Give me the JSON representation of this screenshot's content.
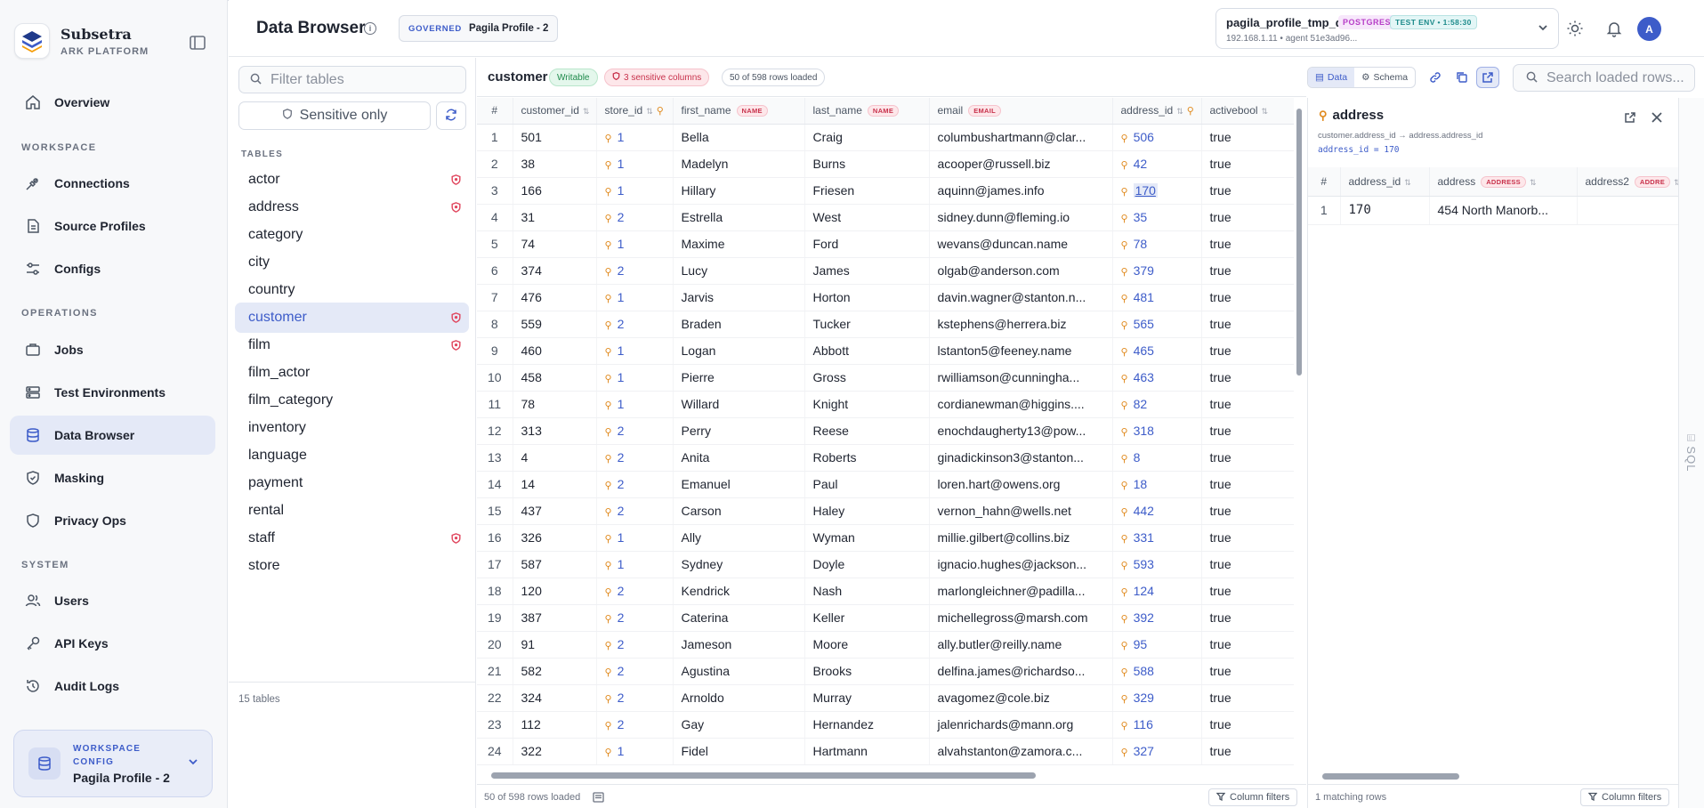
{
  "app": {
    "name": "Subsetra",
    "subtitle": "ARK PLATFORM"
  },
  "nav": {
    "overview": "Overview",
    "workspace_section": "WORKSPACE",
    "connections": "Connections",
    "source_profiles": "Source Profiles",
    "configs": "Configs",
    "operations_section": "OPERATIONS",
    "jobs": "Jobs",
    "test_environments": "Test Environments",
    "data_browser": "Data Browser",
    "masking": "Masking",
    "privacy_ops": "Privacy Ops",
    "system_section": "SYSTEM",
    "users": "Users",
    "api_keys": "API Keys",
    "audit_logs": "Audit Logs"
  },
  "workspace": {
    "label": "WORKSPACE CONFIG",
    "name": "Pagila Profile - 2"
  },
  "header": {
    "title": "Data Browser",
    "governed_tag": "GOVERNED",
    "governed_name": "Pagila Profile - 2",
    "connection": {
      "db": "pagila_profile_tmp_db",
      "engine": "POSTGRES",
      "env": "TEST ENV • 1:58:30",
      "sub": "192.168.1.11 • agent 51e3ad96..."
    },
    "avatar": "A"
  },
  "tables_panel": {
    "filter_placeholder": "Filter tables",
    "sensitive_only": "Sensitive only",
    "heading": "TABLES",
    "items": [
      {
        "name": "actor",
        "sensitive": true
      },
      {
        "name": "address",
        "sensitive": true
      },
      {
        "name": "category",
        "sensitive": false
      },
      {
        "name": "city",
        "sensitive": false
      },
      {
        "name": "country",
        "sensitive": false
      },
      {
        "name": "customer",
        "sensitive": true,
        "active": true
      },
      {
        "name": "film",
        "sensitive": true
      },
      {
        "name": "film_actor",
        "sensitive": false
      },
      {
        "name": "film_category",
        "sensitive": false
      },
      {
        "name": "inventory",
        "sensitive": false
      },
      {
        "name": "language",
        "sensitive": false
      },
      {
        "name": "payment",
        "sensitive": false
      },
      {
        "name": "rental",
        "sensitive": false
      },
      {
        "name": "staff",
        "sensitive": true
      },
      {
        "name": "store",
        "sensitive": false
      }
    ],
    "footer": "15 tables"
  },
  "grid": {
    "table_name": "customer",
    "writable": "Writable",
    "sensitive": "3 sensitive columns",
    "rows_loaded": "50 of 598 rows loaded",
    "view_data": "Data",
    "view_schema": "Schema",
    "search_placeholder": "Search loaded rows...",
    "columns": [
      {
        "label": "#"
      },
      {
        "label": "customer_id",
        "sort": true
      },
      {
        "label": "store_id",
        "sort": true,
        "key": true
      },
      {
        "label": "first_name",
        "tag": "NAME"
      },
      {
        "label": "last_name",
        "tag": "NAME"
      },
      {
        "label": "email",
        "tag": "EMAIL"
      },
      {
        "label": "address_id",
        "sort": true,
        "key": true
      },
      {
        "label": "activebool",
        "sort": true
      }
    ],
    "rows": [
      [
        "1",
        "501",
        "1",
        "Bella",
        "Craig",
        "columbushartmann@clar...",
        "506",
        "true"
      ],
      [
        "2",
        "38",
        "1",
        "Madelyn",
        "Burns",
        "acooper@russell.biz",
        "42",
        "true"
      ],
      [
        "3",
        "166",
        "1",
        "Hillary",
        "Friesen",
        "aquinn@james.info",
        "170",
        "true"
      ],
      [
        "4",
        "31",
        "2",
        "Estrella",
        "West",
        "sidney.dunn@fleming.io",
        "35",
        "true"
      ],
      [
        "5",
        "74",
        "1",
        "Maxime",
        "Ford",
        "wevans@duncan.name",
        "78",
        "true"
      ],
      [
        "6",
        "374",
        "2",
        "Lucy",
        "James",
        "olgab@anderson.com",
        "379",
        "true"
      ],
      [
        "7",
        "476",
        "1",
        "Jarvis",
        "Horton",
        "davin.wagner@stanton.n...",
        "481",
        "true"
      ],
      [
        "8",
        "559",
        "2",
        "Braden",
        "Tucker",
        "kstephens@herrera.biz",
        "565",
        "true"
      ],
      [
        "9",
        "460",
        "1",
        "Logan",
        "Abbott",
        "lstanton5@feeney.name",
        "465",
        "true"
      ],
      [
        "10",
        "458",
        "1",
        "Pierre",
        "Gross",
        "rwilliamson@cunningha...",
        "463",
        "true"
      ],
      [
        "11",
        "78",
        "1",
        "Willard",
        "Knight",
        "cordianewman@higgins....",
        "82",
        "true"
      ],
      [
        "12",
        "313",
        "2",
        "Perry",
        "Reese",
        "enochdaugherty13@pow...",
        "318",
        "true"
      ],
      [
        "13",
        "4",
        "2",
        "Anita",
        "Roberts",
        "ginadickinson3@stanton...",
        "8",
        "true"
      ],
      [
        "14",
        "14",
        "2",
        "Emanuel",
        "Paul",
        "loren.hart@owens.org",
        "18",
        "true"
      ],
      [
        "15",
        "437",
        "2",
        "Carson",
        "Haley",
        "vernon_hahn@wells.net",
        "442",
        "true"
      ],
      [
        "16",
        "326",
        "1",
        "Ally",
        "Wyman",
        "millie.gilbert@collins.biz",
        "331",
        "true"
      ],
      [
        "17",
        "587",
        "1",
        "Sydney",
        "Doyle",
        "ignacio.hughes@jackson...",
        "593",
        "true"
      ],
      [
        "18",
        "120",
        "2",
        "Kendrick",
        "Nash",
        "marlongleichner@padilla...",
        "124",
        "true"
      ],
      [
        "19",
        "387",
        "2",
        "Caterina",
        "Keller",
        "michellegross@marsh.com",
        "392",
        "true"
      ],
      [
        "20",
        "91",
        "2",
        "Jameson",
        "Moore",
        "ally.butler@reilly.name",
        "95",
        "true"
      ],
      [
        "21",
        "582",
        "2",
        "Agustina",
        "Brooks",
        "delfina.james@richardso...",
        "588",
        "true"
      ],
      [
        "22",
        "324",
        "2",
        "Arnoldo",
        "Murray",
        "avagomez@cole.biz",
        "329",
        "true"
      ],
      [
        "23",
        "112",
        "2",
        "Gay",
        "Hernandez",
        "jalenrichards@mann.org",
        "116",
        "true"
      ],
      [
        "24",
        "322",
        "1",
        "Fidel",
        "Hartmann",
        "alvahstanton@zamora.c...",
        "327",
        "true"
      ]
    ],
    "selected_address": "170",
    "footer_rows": "50 of 598 rows loaded",
    "column_filters": "Column filters"
  },
  "detail": {
    "title": "address",
    "path": "customer.address_id → address.address_id",
    "condition": "address_id = 170",
    "columns": [
      {
        "label": "#"
      },
      {
        "label": "address_id",
        "sort": true
      },
      {
        "label": "address",
        "sort": true,
        "tag": "ADDRESS"
      },
      {
        "label": "address2",
        "sort": true,
        "tag": "ADDRE"
      }
    ],
    "rows": [
      [
        "1",
        "170",
        "454 North Manorb...",
        ""
      ]
    ],
    "footer": "1 matching rows",
    "column_filters": "Column filters"
  },
  "sql_tab": "SQL",
  "colors": {
    "accent": "#3d5cc9",
    "sensitive": "#e0455d",
    "key": "#e08a1e"
  }
}
